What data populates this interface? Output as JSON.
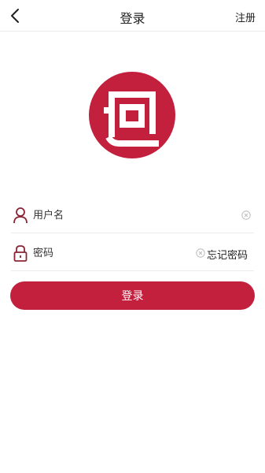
{
  "header": {
    "back_icon": "chevron-left-icon",
    "title": "登录",
    "register_label": "注册"
  },
  "logo": {
    "icon": "brand-logo",
    "color": "#c3203e"
  },
  "form": {
    "username": {
      "placeholder": "用户名",
      "value": "",
      "icon": "user-icon",
      "clear_icon": "clear-icon"
    },
    "password": {
      "placeholder": "密码",
      "value": "",
      "icon": "lock-icon",
      "clear_icon": "clear-icon"
    },
    "forgot_label": "忘记密码"
  },
  "login_button": {
    "label": "登录",
    "color": "#c3203e"
  }
}
